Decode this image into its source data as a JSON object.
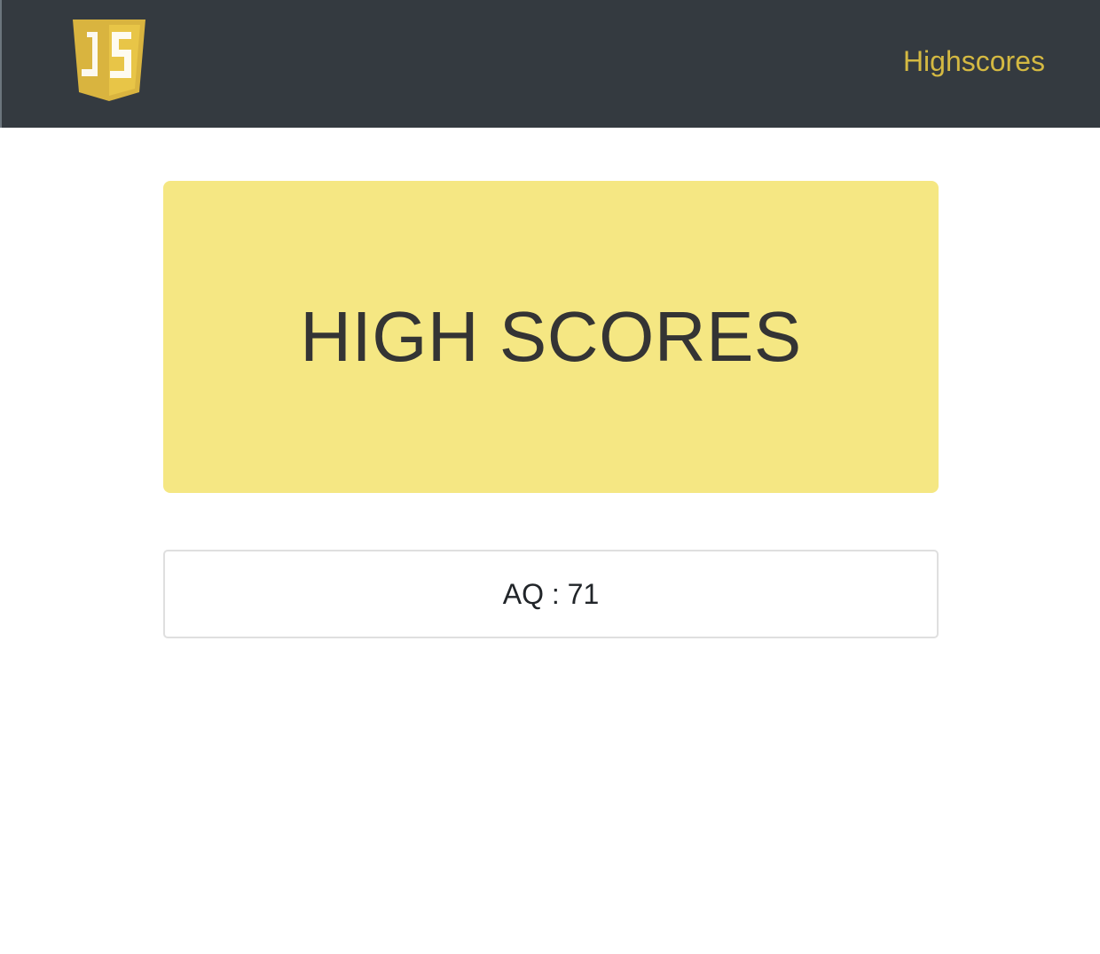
{
  "navbar": {
    "logo_text": "JS",
    "link_label": "Highscores",
    "link_color": "#d4b942",
    "background": "#343a40"
  },
  "jumbotron": {
    "title": "HIGH SCORES",
    "background": "#f5e783"
  },
  "scores": [
    {
      "text": "AQ : 71"
    }
  ]
}
